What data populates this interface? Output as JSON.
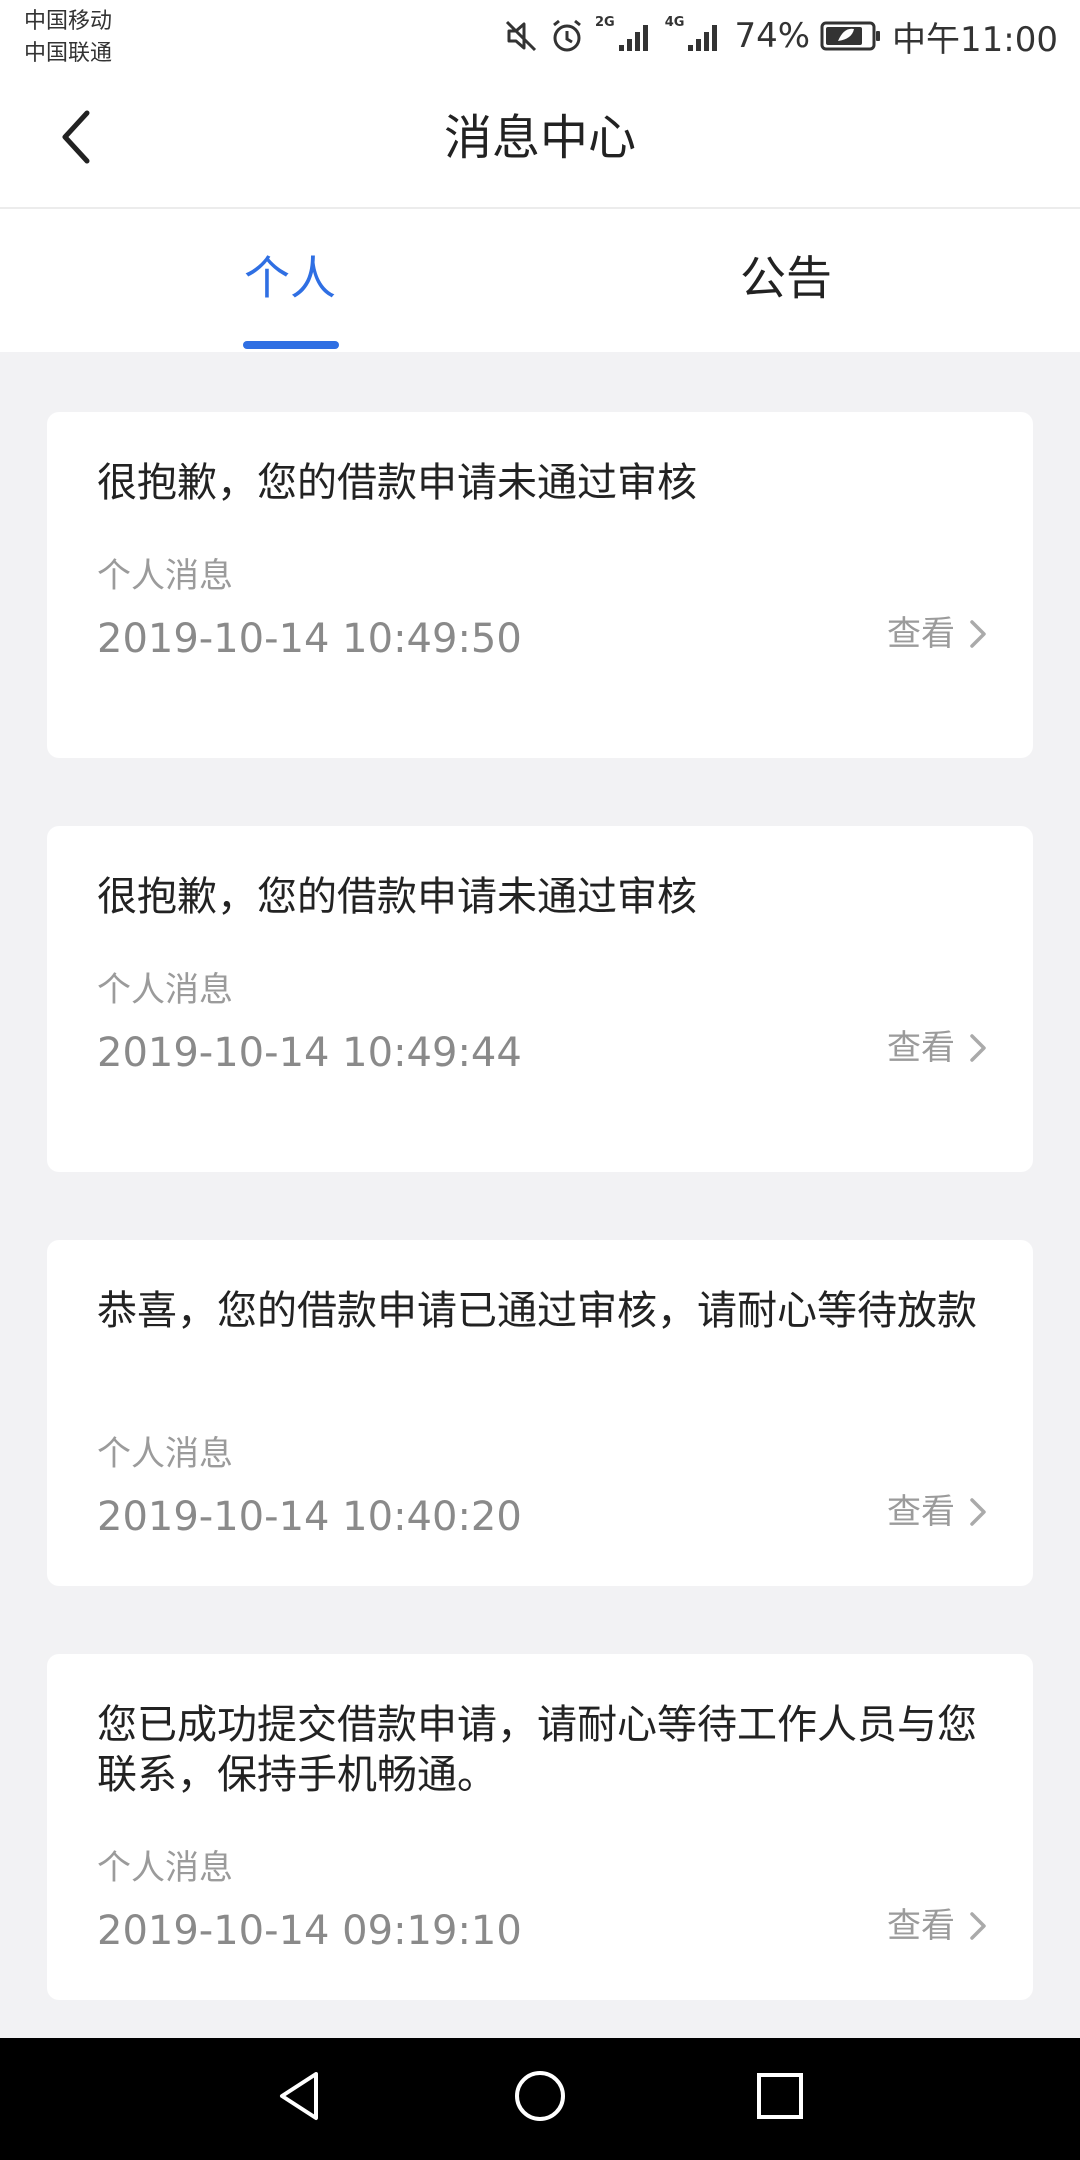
{
  "status_bar": {
    "carrier_1": "中国移动",
    "carrier_2": "中国联通",
    "network_1": "2G",
    "network_2": "4G",
    "battery": "74%",
    "time": "中午11:00",
    "icons": [
      "mute-icon",
      "alarm-icon",
      "signal-icon",
      "battery-icon"
    ]
  },
  "header": {
    "title": "消息中心",
    "back_icon": "chevron-left-icon"
  },
  "tabs": {
    "items": [
      {
        "label": "个人",
        "active": true
      },
      {
        "label": "公告",
        "active": false
      }
    ],
    "active_color": "#2f6fe3"
  },
  "messages": [
    {
      "title": "很抱歉，您的借款申请未通过审核",
      "category": "个人消息",
      "time": "2019-10-14 10:49:50",
      "action": "查看"
    },
    {
      "title": "很抱歉，您的借款申请未通过审核",
      "category": "个人消息",
      "time": "2019-10-14 10:49:44",
      "action": "查看"
    },
    {
      "title": "恭喜，您的借款申请已通过审核，请耐心等待放款",
      "category": "个人消息",
      "time": "2019-10-14 10:40:20",
      "action": "查看"
    },
    {
      "title": "您已成功提交借款申请，请耐心等待工作人员与您联系，保持手机畅通。",
      "category": "个人消息",
      "time": "2019-10-14 09:19:10",
      "action": "查看"
    }
  ],
  "nav_bar": {
    "icons": [
      "nav-back-icon",
      "nav-home-icon",
      "nav-recent-icon"
    ]
  }
}
